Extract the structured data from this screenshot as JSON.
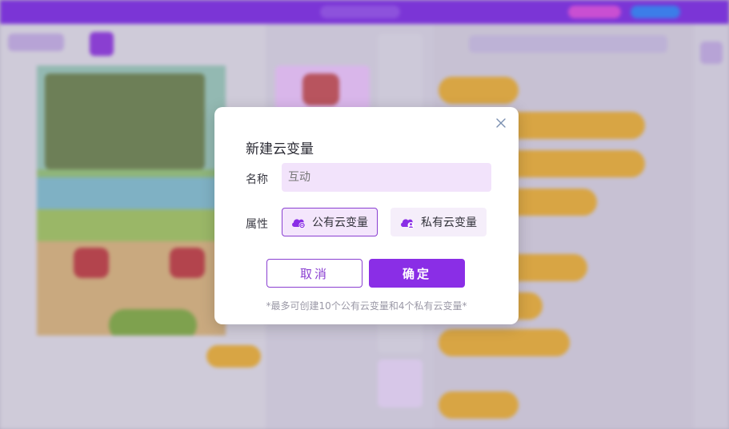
{
  "dialog": {
    "title": "新建云变量",
    "name_label": "名称",
    "name_placeholder": "互动",
    "attribute_label": "属性",
    "options": [
      {
        "label": "公有云变量",
        "icon": "public-cloud-icon",
        "selected": true
      },
      {
        "label": "私有云变量",
        "icon": "private-cloud-icon",
        "selected": false
      }
    ],
    "cancel_label": "取消",
    "confirm_label": "确定",
    "note": "*最多可创建10个公有云变量和4个私有云变量*",
    "close_icon": "close-icon"
  },
  "colors": {
    "accent": "#8a2ee6",
    "selected_border": "#8a3fd1",
    "input_bg": "#f2e3fb",
    "topbar": "#7b35d6",
    "block": "#d8a544"
  }
}
